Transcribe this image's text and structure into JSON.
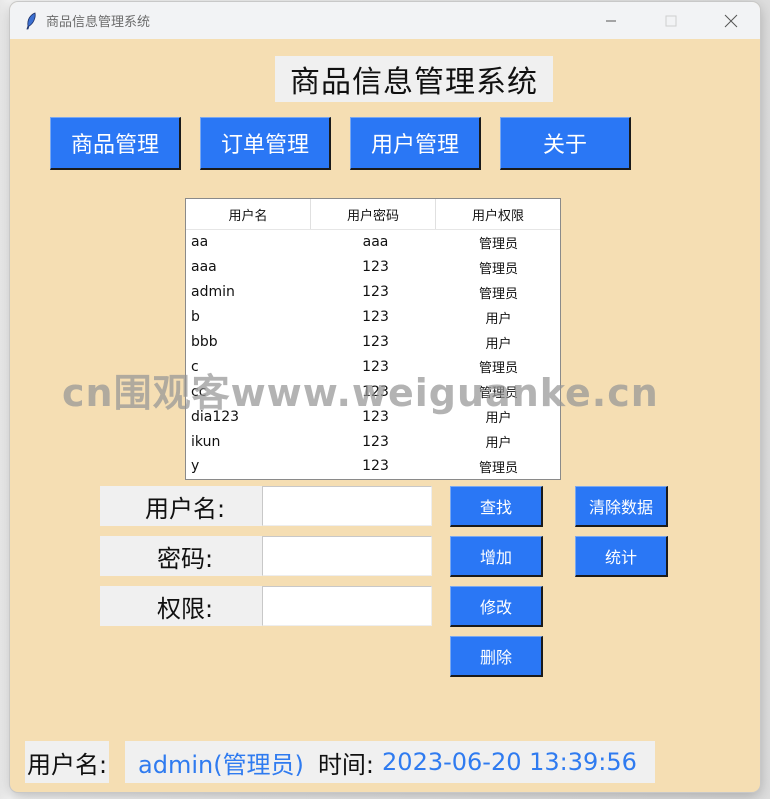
{
  "window": {
    "title": "商品信息管理系统",
    "controls": {
      "minimize": "—",
      "close": "✕"
    }
  },
  "app_title": "商品信息管理系统",
  "nav": [
    {
      "label": "商品管理"
    },
    {
      "label": "订单管理"
    },
    {
      "label": "用户管理"
    },
    {
      "label": "关于"
    }
  ],
  "table": {
    "columns": [
      "用户名",
      "用户密码",
      "用户权限"
    ],
    "rows": [
      [
        "aa",
        "aaa",
        "管理员"
      ],
      [
        "aaa",
        "123",
        "管理员"
      ],
      [
        "admin",
        "123",
        "管理员"
      ],
      [
        "b",
        "123",
        "用户"
      ],
      [
        "bbb",
        "123",
        "用户"
      ],
      [
        "c",
        "123",
        "管理员"
      ],
      [
        "cc",
        "123",
        "管理员"
      ],
      [
        "dia123",
        "123",
        "用户"
      ],
      [
        "ikun",
        "123",
        "用户"
      ],
      [
        "y",
        "123",
        "管理员"
      ]
    ]
  },
  "form": {
    "username_label": "用户名:",
    "username_value": "",
    "password_label": "密码:",
    "password_value": "",
    "permission_label": "权限:",
    "permission_value": ""
  },
  "actions": {
    "search": "查找",
    "add": "增加",
    "modify": "修改",
    "delete": "删除",
    "clear": "清除数据",
    "stats": "统计"
  },
  "status": {
    "user_label": "用户名:",
    "user_value": "admin(管理员)",
    "time_label": "时间:",
    "time_value": "2023-06-20 13:39:56"
  },
  "watermark": "cn围观客www.weiguanke.cn",
  "colors": {
    "window_bg": "#f5deb3",
    "button_blue": "#2a77f5",
    "status_blue": "#2f7bf0"
  }
}
